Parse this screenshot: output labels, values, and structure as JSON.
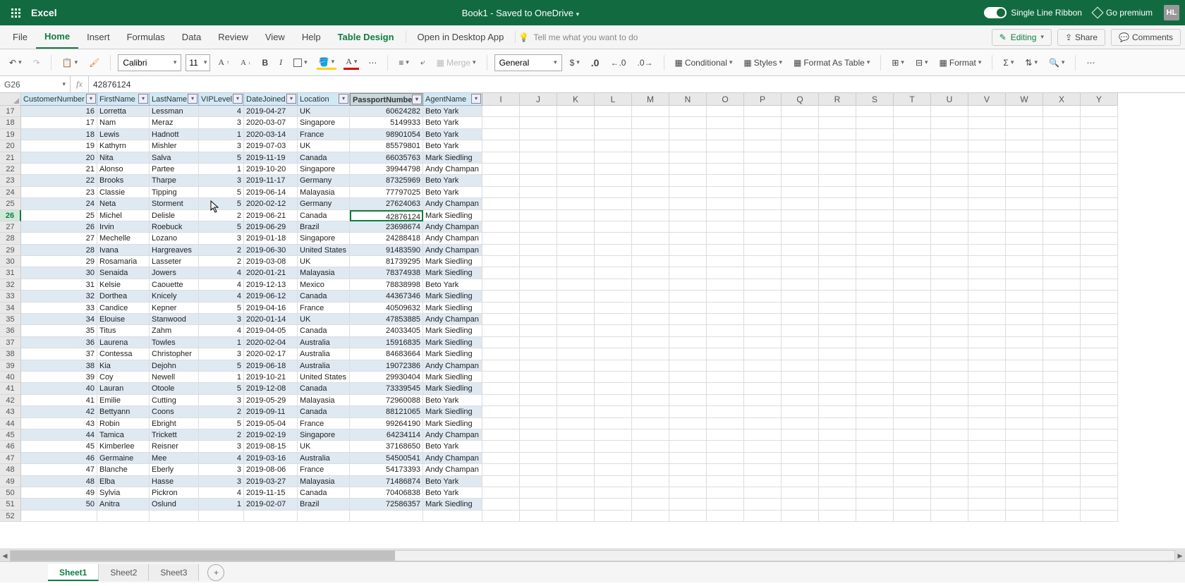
{
  "titlebar": {
    "app": "Excel",
    "doc": "Book1 - Saved to OneDrive",
    "single_line": "Single Line Ribbon",
    "premium": "Go premium",
    "avatar": "HL"
  },
  "tabs": {
    "file": "File",
    "home": "Home",
    "insert": "Insert",
    "formulas": "Formulas",
    "data": "Data",
    "review": "Review",
    "view": "View",
    "help": "Help",
    "table_design": "Table Design",
    "open_desktop": "Open in Desktop App",
    "tell_me": "Tell me what you want to do",
    "editing": "Editing",
    "share": "Share",
    "comments": "Comments"
  },
  "ribbon": {
    "font_name": "Calibri",
    "font_size": "11",
    "bold": "B",
    "italic": "I",
    "merge": "Merge",
    "num_format": "General",
    "conditional": "Conditional",
    "styles": "Styles",
    "format_table": "Format As Table",
    "format": "Format"
  },
  "namebox": {
    "ref": "G26",
    "formula": "42876124"
  },
  "columns_extra": [
    "I",
    "J",
    "K",
    "L",
    "M",
    "N",
    "O",
    "P",
    "Q",
    "R",
    "S",
    "T",
    "U",
    "V",
    "W",
    "X",
    "Y"
  ],
  "headers": [
    "CustomerNumber",
    "FirstName",
    "LastName",
    "VIPLevel",
    "DateJoined",
    "Location",
    "PassportNumber",
    "AgentName"
  ],
  "rows": [
    {
      "n": 17,
      "d": [
        16,
        "Lorretta",
        "Lessman",
        4,
        "2019-04-27",
        "UK",
        "60624282",
        "Beto Yark"
      ]
    },
    {
      "n": 18,
      "d": [
        17,
        "Nam",
        "Meraz",
        3,
        "2020-03-07",
        "Singapore",
        "5149933",
        "Beto Yark"
      ]
    },
    {
      "n": 19,
      "d": [
        18,
        "Lewis",
        "Hadnott",
        1,
        "2020-03-14",
        "France",
        "98901054",
        "Beto Yark"
      ]
    },
    {
      "n": 20,
      "d": [
        19,
        "Kathyrn",
        "Mishler",
        3,
        "2019-07-03",
        "UK",
        "85579801",
        "Beto Yark"
      ]
    },
    {
      "n": 21,
      "d": [
        20,
        "Nita",
        "Salva",
        5,
        "2019-11-19",
        "Canada",
        "66035763",
        "Mark Siedling"
      ]
    },
    {
      "n": 22,
      "d": [
        21,
        "Alonso",
        "Partee",
        1,
        "2019-10-20",
        "Singapore",
        "39944798",
        "Andy Champan"
      ]
    },
    {
      "n": 23,
      "d": [
        22,
        "Brooks",
        "Tharpe",
        3,
        "2019-11-17",
        "Germany",
        "87325969",
        "Beto Yark"
      ]
    },
    {
      "n": 24,
      "d": [
        23,
        "Classie",
        "Tipping",
        5,
        "2019-06-14",
        "Malayasia",
        "77797025",
        "Beto Yark"
      ]
    },
    {
      "n": 25,
      "d": [
        24,
        "Neta",
        "Storment",
        5,
        "2020-02-12",
        "Germany",
        "27624063",
        "Andy Champan"
      ]
    },
    {
      "n": 26,
      "d": [
        25,
        "Michel",
        "Delisle",
        2,
        "2019-06-21",
        "Canada",
        "42876124",
        "Mark Siedling"
      ]
    },
    {
      "n": 27,
      "d": [
        26,
        "Irvin",
        "Roebuck",
        5,
        "2019-06-29",
        "Brazil",
        "23698674",
        "Andy Champan"
      ]
    },
    {
      "n": 28,
      "d": [
        27,
        "Mechelle",
        "Lozano",
        3,
        "2019-01-18",
        "Singapore",
        "24288418",
        "Andy Champan"
      ]
    },
    {
      "n": 29,
      "d": [
        28,
        "Ivana",
        "Hargreaves",
        2,
        "2019-06-30",
        "United States",
        "91483590",
        "Andy Champan"
      ]
    },
    {
      "n": 30,
      "d": [
        29,
        "Rosamaria",
        "Lasseter",
        2,
        "2019-03-08",
        "UK",
        "81739295",
        "Mark Siedling"
      ]
    },
    {
      "n": 31,
      "d": [
        30,
        "Senaida",
        "Jowers",
        4,
        "2020-01-21",
        "Malayasia",
        "78374938",
        "Mark Siedling"
      ]
    },
    {
      "n": 32,
      "d": [
        31,
        "Kelsie",
        "Caouette",
        4,
        "2019-12-13",
        "Mexico",
        "78838998",
        "Beto Yark"
      ]
    },
    {
      "n": 33,
      "d": [
        32,
        "Dorthea",
        "Knicely",
        4,
        "2019-06-12",
        "Canada",
        "44367346",
        "Mark Siedling"
      ]
    },
    {
      "n": 34,
      "d": [
        33,
        "Candice",
        "Kepner",
        5,
        "2019-04-16",
        "France",
        "40509632",
        "Mark Siedling"
      ]
    },
    {
      "n": 35,
      "d": [
        34,
        "Elouise",
        "Stanwood",
        3,
        "2020-01-14",
        "UK",
        "47853885",
        "Andy Champan"
      ]
    },
    {
      "n": 36,
      "d": [
        35,
        "Titus",
        "Zahm",
        4,
        "2019-04-05",
        "Canada",
        "24033405",
        "Mark Siedling"
      ]
    },
    {
      "n": 37,
      "d": [
        36,
        "Laurena",
        "Towles",
        1,
        "2020-02-04",
        "Australia",
        "15916835",
        "Mark Siedling"
      ]
    },
    {
      "n": 38,
      "d": [
        37,
        "Contessa",
        "Christopher",
        3,
        "2020-02-17",
        "Australia",
        "84683664",
        "Mark Siedling"
      ]
    },
    {
      "n": 39,
      "d": [
        38,
        "Kia",
        "Dejohn",
        5,
        "2019-06-18",
        "Australia",
        "19072386",
        "Andy Champan"
      ]
    },
    {
      "n": 40,
      "d": [
        39,
        "Coy",
        "Newell",
        1,
        "2019-10-21",
        "United States",
        "29930404",
        "Mark Siedling"
      ]
    },
    {
      "n": 41,
      "d": [
        40,
        "Lauran",
        "Otoole",
        5,
        "2019-12-08",
        "Canada",
        "73339545",
        "Mark Siedling"
      ]
    },
    {
      "n": 42,
      "d": [
        41,
        "Emilie",
        "Cutting",
        3,
        "2019-05-29",
        "Malayasia",
        "72960088",
        "Beto Yark"
      ]
    },
    {
      "n": 43,
      "d": [
        42,
        "Bettyann",
        "Coons",
        2,
        "2019-09-11",
        "Canada",
        "88121065",
        "Mark Siedling"
      ]
    },
    {
      "n": 44,
      "d": [
        43,
        "Robin",
        "Ebright",
        5,
        "2019-05-04",
        "France",
        "99264190",
        "Mark Siedling"
      ]
    },
    {
      "n": 45,
      "d": [
        44,
        "Tamica",
        "Trickett",
        2,
        "2019-02-19",
        "Singapore",
        "64234114",
        "Andy Champan"
      ]
    },
    {
      "n": 46,
      "d": [
        45,
        "Kimberlee",
        "Reisner",
        3,
        "2019-08-15",
        "UK",
        "37168650",
        "Beto Yark"
      ]
    },
    {
      "n": 47,
      "d": [
        46,
        "Germaine",
        "Mee",
        4,
        "2019-03-16",
        "Australia",
        "54500541",
        "Andy Champan"
      ]
    },
    {
      "n": 48,
      "d": [
        47,
        "Blanche",
        "Eberly",
        3,
        "2019-08-06",
        "France",
        "54173393",
        "Andy Champan"
      ]
    },
    {
      "n": 49,
      "d": [
        48,
        "Elba",
        "Hasse",
        3,
        "2019-03-27",
        "Malayasia",
        "71486874",
        "Beto Yark"
      ]
    },
    {
      "n": 50,
      "d": [
        49,
        "Sylvia",
        "Pickron",
        4,
        "2019-11-15",
        "Canada",
        "70406838",
        "Beto Yark"
      ]
    },
    {
      "n": 51,
      "d": [
        50,
        "Anitra",
        "Oslund",
        1,
        "2019-02-07",
        "Brazil",
        "72586357",
        "Mark Siedling"
      ]
    }
  ],
  "blank_row": 52,
  "selected": {
    "row": 26,
    "col": 6
  },
  "sheets": {
    "s1": "Sheet1",
    "s2": "Sheet2",
    "s3": "Sheet3"
  }
}
